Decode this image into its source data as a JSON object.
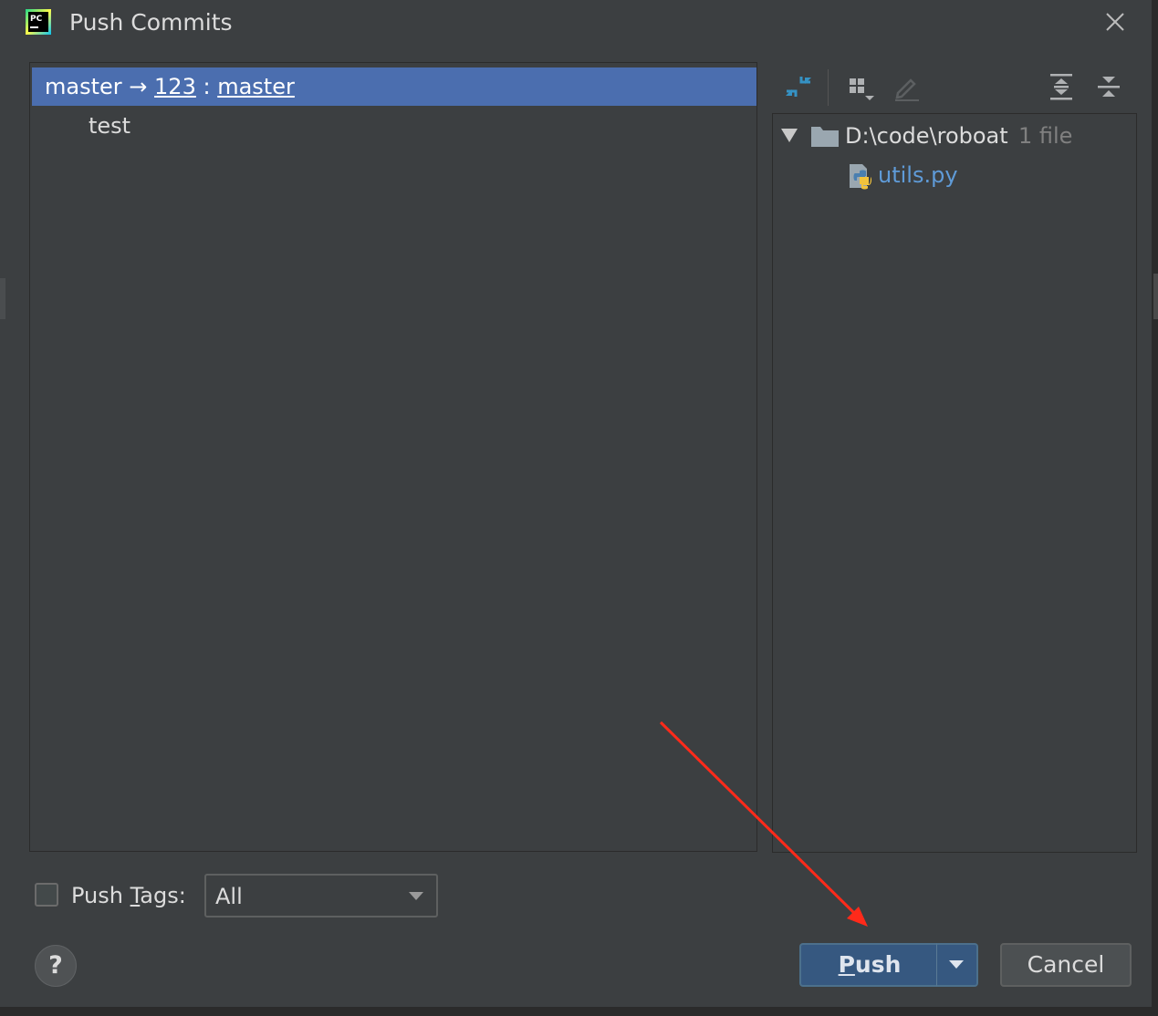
{
  "window": {
    "title": "Push Commits",
    "app_icon": "pycharm-icon",
    "close_icon": "close-icon"
  },
  "commits_panel": {
    "branch": {
      "local": "master",
      "arrow": "→",
      "remote": "123",
      "separator": ":",
      "remote_branch": "master"
    },
    "commits": [
      {
        "message": "test"
      }
    ]
  },
  "toolbar": {
    "buttons": [
      {
        "name": "show-diff",
        "icon": "diff-arrows-icon"
      },
      {
        "name": "group-by",
        "icon": "group-by-icon"
      },
      {
        "name": "edit-source",
        "icon": "pencil-icon",
        "enabled": false
      },
      {
        "name": "expand-all",
        "icon": "expand-all-icon"
      },
      {
        "name": "collapse-all",
        "icon": "collapse-all-icon"
      }
    ]
  },
  "file_tree": {
    "root": {
      "path": "D:\\code\\roboat",
      "count": "1 file",
      "icon": "folder-icon",
      "expanded": true
    },
    "files": [
      {
        "name": "utils.py",
        "icon": "python-file-icon"
      }
    ]
  },
  "footer": {
    "push_tags": {
      "checked": false,
      "label_before": "Push ",
      "label_mnemonic": "T",
      "label_after": "ags:",
      "combo_value": "All"
    },
    "help_symbol": "?",
    "push_button": {
      "mnemonic": "P",
      "rest": "ush"
    },
    "cancel_label": "Cancel"
  },
  "colors": {
    "background": "#3c3f41",
    "selection": "#4b6eaf",
    "primary_button": "#365880",
    "file_modified": "#5f9bd8",
    "annotation_arrow": "#ff2a1a"
  }
}
